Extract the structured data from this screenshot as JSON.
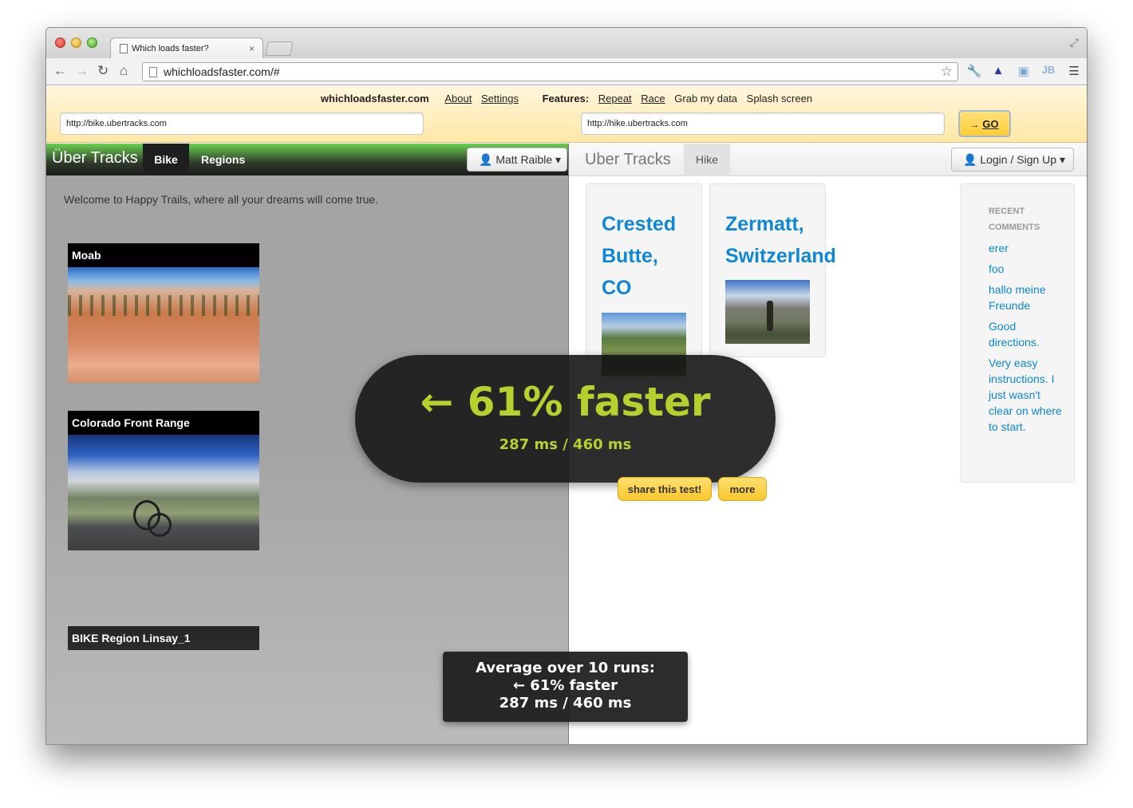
{
  "browser": {
    "tab_title": "Which loads faster?",
    "tab_close": "×",
    "url": "whichloadsfaster.com/#"
  },
  "wlf": {
    "brand": "whichloadsfaster.com",
    "menu": {
      "about": "About",
      "settings": "Settings",
      "features_label": "Features:",
      "repeat": "Repeat",
      "race": "Race",
      "grab": "Grab my data",
      "splash": "Splash screen"
    },
    "left_url": "http://bike.ubertracks.com",
    "right_url": "http://hike.ubertracks.com",
    "go_label": "GO",
    "go_arrow": "→"
  },
  "left": {
    "brand": "Über Tracks",
    "nav_active": "Bike",
    "nav_regions": "Regions",
    "user": "Matt Raible",
    "welcome": "Welcome to Happy Trails, where all your dreams will come true.",
    "cards": [
      {
        "title": "Moab"
      },
      {
        "title": "Colorado Front Range"
      }
    ],
    "region_bar": "BIKE Region Linsay_1"
  },
  "right": {
    "brand": "Uber Tracks",
    "nav_hike": "Hike",
    "login": "Login / Sign Up",
    "trips": [
      {
        "title_lines": [
          "Crested",
          "Butte,",
          "CO"
        ]
      },
      {
        "title_lines": [
          "Zermatt,",
          "Switzerland"
        ]
      }
    ],
    "comments_heading_1": "RECENT",
    "comments_heading_2": "COMMENTS",
    "comments": [
      "erer",
      "foo",
      "hallo meine Freunde",
      "Good directions.",
      "Very easy instructions. I just wasn't clear on where to start."
    ]
  },
  "result": {
    "headline": "← 61% faster",
    "timing": "287 ms / 460 ms",
    "share_label": "share this test!",
    "more_label": "more",
    "avg_line1": "Average over 10 runs:",
    "avg_line2": "← 61% faster",
    "avg_line3": "287 ms / 460 ms"
  },
  "colors": {
    "accent_green": "#b5d12e",
    "link_blue": "#0d87d6",
    "button_yellow": "#ffcc36"
  }
}
